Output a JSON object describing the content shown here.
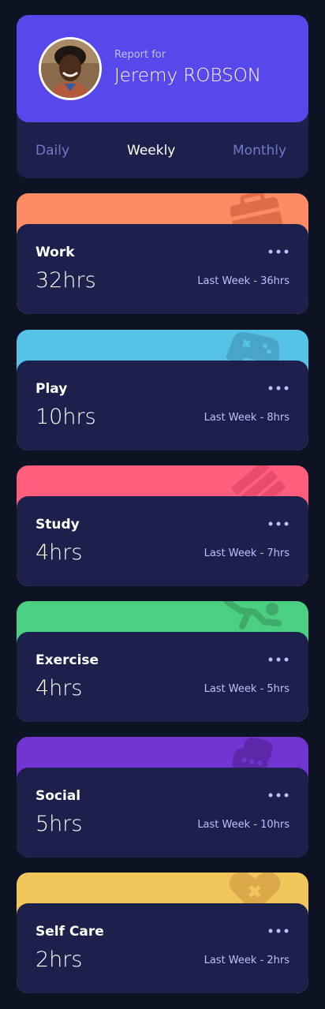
{
  "profile": {
    "report_for": "Report for",
    "name": "Jeremy ROBSON"
  },
  "tabs": [
    {
      "label": "Daily",
      "active": false
    },
    {
      "label": "Weekly",
      "active": true
    },
    {
      "label": "Monthly",
      "active": false
    }
  ],
  "activities": [
    {
      "title": "Work",
      "hours": "32hrs",
      "previous": "Last Week - 36hrs",
      "color": "#ff8b64",
      "icon": "briefcase-icon"
    },
    {
      "title": "Play",
      "hours": "10hrs",
      "previous": "Last Week - 8hrs",
      "color": "#55c2e6",
      "icon": "gamepad-icon"
    },
    {
      "title": "Study",
      "hours": "4hrs",
      "previous": "Last Week - 7hrs",
      "color": "#ff5e7d",
      "icon": "book-icon"
    },
    {
      "title": "Exercise",
      "hours": "4hrs",
      "previous": "Last Week - 5hrs",
      "color": "#4bcf82",
      "icon": "running-icon"
    },
    {
      "title": "Social",
      "hours": "5hrs",
      "previous": "Last Week - 10hrs",
      "color": "#7335d2",
      "icon": "chat-icon"
    },
    {
      "title": "Self Care",
      "hours": "2hrs",
      "previous": "Last Week - 2hrs",
      "color": "#f1c75b",
      "icon": "heart-icon"
    }
  ],
  "colors": {
    "page_bg": "#0e1323",
    "card_bg": "#1c204b",
    "profile_bg": "#5847eb",
    "muted_text": "#bbc0ff",
    "tab_inactive": "#7078c9"
  }
}
